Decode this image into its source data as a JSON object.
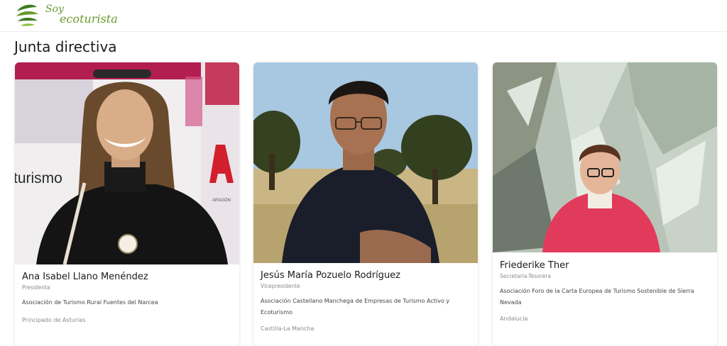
{
  "header": {
    "logo_line1": "Soy",
    "logo_line2": "ecoturista"
  },
  "page": {
    "title": "Junta directiva"
  },
  "members": [
    {
      "name": "Ana Isabel Llano Menéndez",
      "role": "Presidenta",
      "organization": "Asociación de Turismo Rural Fuentes del Narcea",
      "region": "Principado de Asturias",
      "photo_text_left": "turismo",
      "photo_text_right": "ARAGÓN"
    },
    {
      "name": "Jesús María Pozuelo Rodríguez",
      "role": "Vicepresidente",
      "organization": "Asociación Castellano Manchega de Empresas de Turismo Activo y Ecoturismo",
      "region": "Castilla-La Mancha"
    },
    {
      "name": "Friederike Ther",
      "role": "Secretaria-Tesorera",
      "organization": "Asociación Foro de la Carta Europea de Turismo Sostenible de Sierra Nevada",
      "region": "Andalucía"
    }
  ],
  "colors": {
    "brand_green": "#6a9a2f",
    "brand_dark_green": "#3f7a22"
  }
}
